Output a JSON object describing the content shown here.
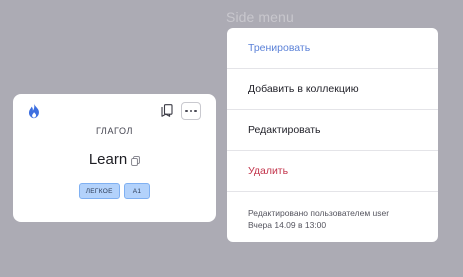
{
  "background": {
    "caption": "Side menu"
  },
  "card": {
    "part_of_speech": "ГЛАГОЛ",
    "word": "Learn",
    "tags": [
      "ЛЕГКОЕ",
      "A1"
    ],
    "icons": {
      "streak": "fire-icon",
      "bookmark": "bookmark-icon",
      "more": "more-icon",
      "copy": "copy-icon"
    }
  },
  "menu": {
    "items": [
      {
        "label": "Тренировать",
        "color": "#5c82d8"
      },
      {
        "label": "Добавить в коллекцию",
        "color": "#1f1f27"
      },
      {
        "label": "Редактировать",
        "color": "#1f1f27"
      },
      {
        "label": "Удалить",
        "color": "#c2334a"
      }
    ],
    "footer": {
      "edited_by": "Редактировано пользователем user",
      "edited_at": "Вчера 14.09 в 13:00"
    }
  },
  "colors": {
    "overlay": "#acabb4",
    "accent": "#5c82d8",
    "danger": "#c2334a",
    "tag_fill": "#b3d2fb",
    "streak_icon": "#3d6fe0"
  }
}
